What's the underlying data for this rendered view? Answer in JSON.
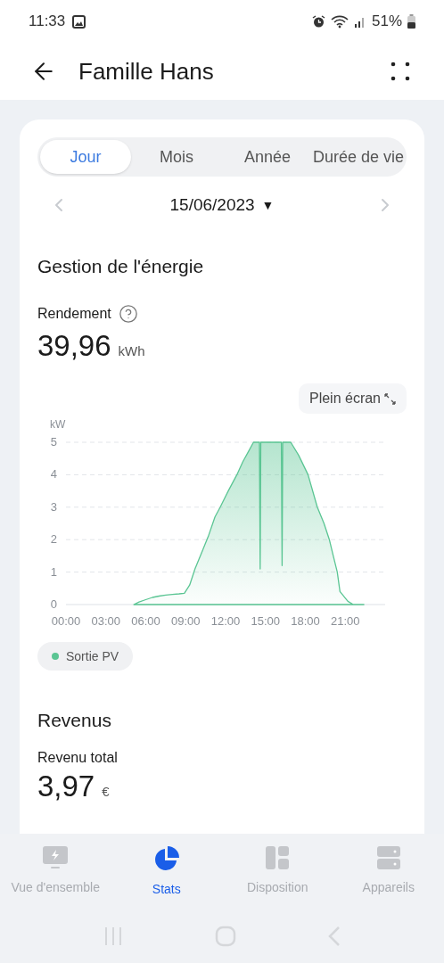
{
  "status_bar": {
    "time": "11:33",
    "battery": "51%"
  },
  "header": {
    "title": "Famille Hans"
  },
  "period_tabs": [
    {
      "label": "Jour",
      "selected": true
    },
    {
      "label": "Mois",
      "selected": false
    },
    {
      "label": "Année",
      "selected": false
    },
    {
      "label": "Durée de vie",
      "selected": false
    }
  ],
  "date": {
    "value": "15/06/2023",
    "caret": "▼"
  },
  "energy": {
    "title": "Gestion de l'énergie",
    "metric_label": "Rendement",
    "value": "39,96",
    "unit": "kWh",
    "fullscreen_button": "Plein écran",
    "chart_data": {
      "type": "area",
      "grid": true,
      "ylabel": "kW",
      "xlim": [
        0,
        24
      ],
      "ylim": [
        0,
        5
      ],
      "yticks": [
        0,
        1,
        2,
        3,
        4,
        5
      ],
      "xticks": [
        {
          "value": 0,
          "label": "00:00"
        },
        {
          "value": 3,
          "label": "03:00"
        },
        {
          "value": 6,
          "label": "06:00"
        },
        {
          "value": 9,
          "label": "09:00"
        },
        {
          "value": 12,
          "label": "12:00"
        },
        {
          "value": 15,
          "label": "15:00"
        },
        {
          "value": 18,
          "label": "18:00"
        },
        {
          "value": 21,
          "label": "21:00"
        }
      ],
      "x": [
        5.1,
        5.5,
        6,
        6.5,
        7,
        7.5,
        8,
        8.5,
        8.9,
        9.3,
        9.7,
        10.2,
        10.7,
        11.2,
        11.6,
        12.2,
        12.85,
        13.3,
        13.7,
        14.1,
        14.55,
        14.6,
        14.65,
        15,
        15.5,
        16.2,
        16.25,
        16.3,
        16.9,
        17.5,
        18.2,
        18.9,
        19.4,
        19.8,
        20.1,
        20.4,
        20.6,
        21.2,
        21.6,
        22.4
      ],
      "series": [
        {
          "name": "Sortie PV",
          "color": "#5ac593",
          "values": [
            0,
            0.08,
            0.15,
            0.22,
            0.26,
            0.29,
            0.31,
            0.33,
            0.35,
            0.6,
            1.1,
            1.6,
            2.1,
            2.7,
            3.0,
            3.5,
            4.0,
            4.4,
            4.7,
            5,
            5,
            1.1,
            5,
            5,
            5,
            5,
            1.2,
            5,
            5,
            4.6,
            4.0,
            3.0,
            2.5,
            2.0,
            1.5,
            1.0,
            0.4,
            0.1,
            0,
            0
          ]
        }
      ]
    }
  },
  "revenue": {
    "title": "Revenus",
    "metric_label": "Revenu total",
    "value": "3,97",
    "unit": "€"
  },
  "bottom_nav": [
    {
      "label": "Vue d'ensemble",
      "selected": false
    },
    {
      "label": "Stats",
      "selected": true
    },
    {
      "label": "Disposition",
      "selected": false
    },
    {
      "label": "Appareils",
      "selected": false
    }
  ]
}
